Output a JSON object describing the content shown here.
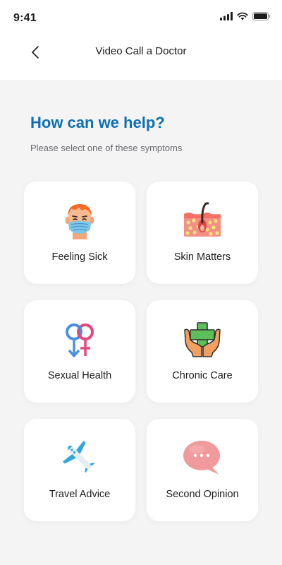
{
  "status_bar": {
    "time": "9:41"
  },
  "nav": {
    "title": "Video Call a Doctor"
  },
  "main": {
    "heading": "How can we help?",
    "subheading": "Please select one of these symptoms",
    "options": [
      {
        "label": "Feeling Sick",
        "icon": "sick-person-mask-icon"
      },
      {
        "label": "Skin Matters",
        "icon": "skin-hair-follicle-icon"
      },
      {
        "label": "Sexual Health",
        "icon": "gender-symbols-icon"
      },
      {
        "label": "Chronic Care",
        "icon": "hands-medical-cross-icon"
      },
      {
        "label": "Travel Advice",
        "icon": "airplane-icon"
      },
      {
        "label": "Second Opinion",
        "icon": "speech-bubble-icon"
      }
    ]
  },
  "colors": {
    "accent": "#0e6fb5",
    "background": "#f4f4f5",
    "card": "#ffffff"
  }
}
